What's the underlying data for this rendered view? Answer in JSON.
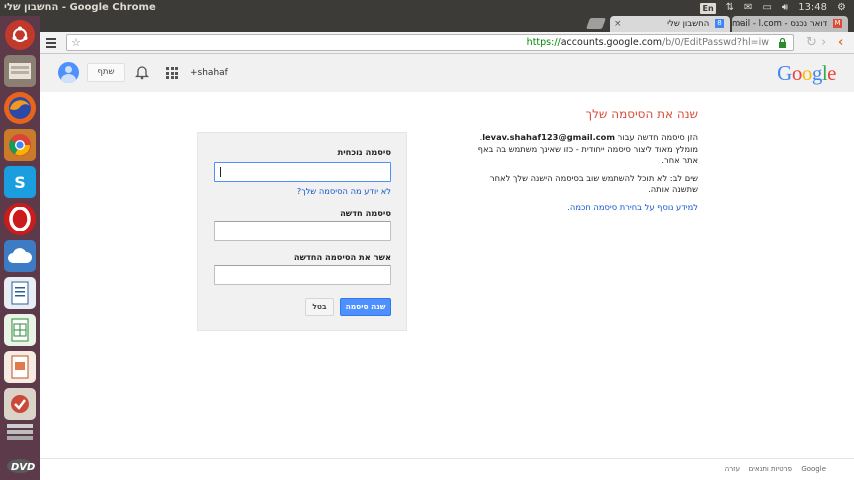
{
  "topbar": {
    "title": "החשבון שלי - Google Chrome",
    "keyboard": "En",
    "time": "13:48"
  },
  "tabs": [
    {
      "title": "דואר נכנס - Gmail - l.com",
      "favicon": "gmail-icon"
    },
    {
      "title": "החשבון שלי",
      "favicon": "google-account-icon"
    }
  ],
  "omnibox": {
    "scheme": "https://",
    "host": "accounts.google.com",
    "path": "/b/0/EditPasswd?hl=iw"
  },
  "gbar": {
    "share_label": "שתף",
    "user_label": "+shahaf"
  },
  "logo": {
    "letters": [
      "G",
      "o",
      "o",
      "g",
      "l",
      "e"
    ],
    "colors": [
      "#4285f4",
      "#ea4335",
      "#fbbc05",
      "#4285f4",
      "#34a853",
      "#ea4335"
    ]
  },
  "page": {
    "title": "שנה את הסיסמה שלך",
    "desc1_prefix": "הזן סיסמה חדשה עבור ",
    "email": "levav.shahaf123@gmail.com",
    "desc1_suffix": ". מומלץ מאוד ליצור סיסמה ייחודית - כזו שאינך משתמש בה באף אתר אחר.",
    "desc2": "שים לב: לא תוכל להשתמש שוב בסיסמה הישנה שלך לאחר שתשנה אותה.",
    "more_link": "למידע נוסף על בחירת סיסמה חכמה."
  },
  "form": {
    "current_label": "סיסמה נוכחית",
    "forgot_link": "לא יודע מה הסיסמה שלך?",
    "new_label": "סיסמה חדשה",
    "confirm_label": "אשר את הסיסמה החדשה",
    "submit_label": "שנה סיסמה",
    "cancel_label": "בטל"
  },
  "footer": {
    "google": "Google",
    "privacy": "פרטיות ותנאים",
    "help": "עזרה"
  },
  "colors": {
    "accent": "#dd4b39",
    "link": "#1155cc",
    "button": "#4d90fe"
  }
}
